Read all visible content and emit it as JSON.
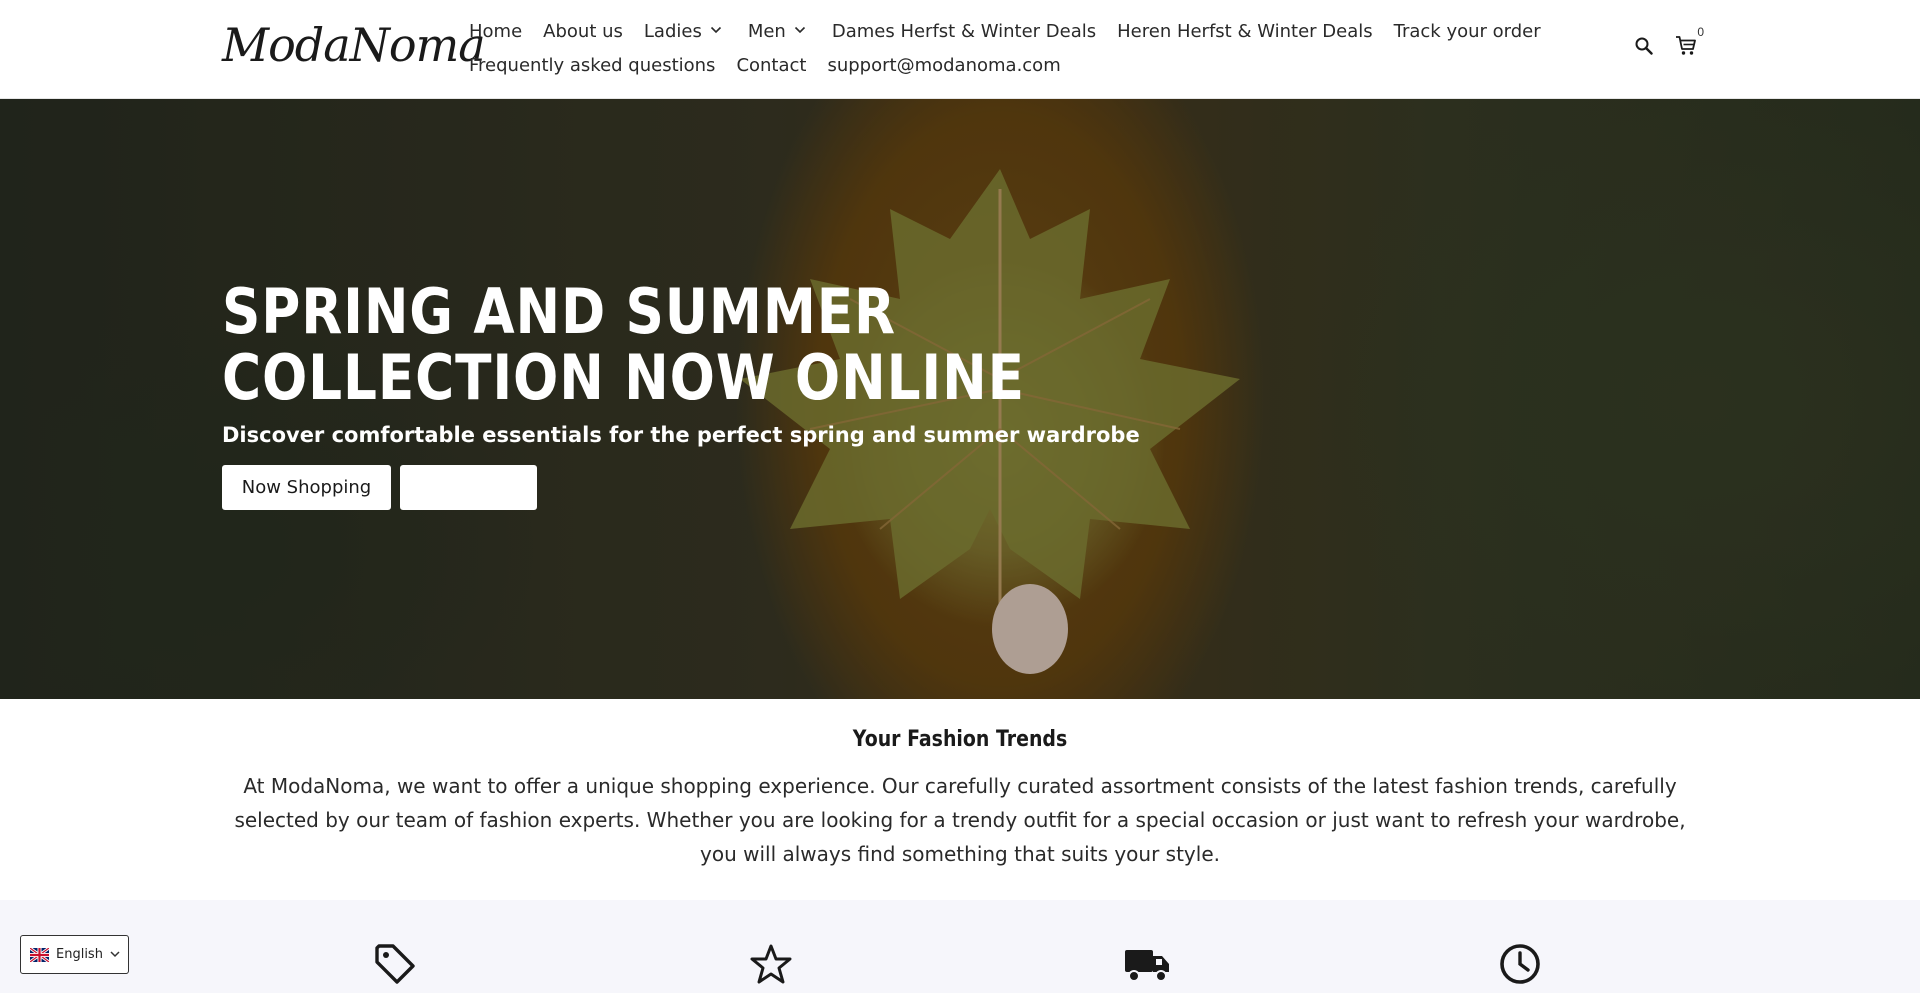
{
  "header": {
    "logo": "ModaNoma",
    "nav_row1": [
      {
        "label": "Home",
        "dropdown": false
      },
      {
        "label": "About us",
        "dropdown": false
      },
      {
        "label": "Ladies",
        "dropdown": true
      },
      {
        "label": "Men",
        "dropdown": true
      },
      {
        "label": "Dames Herfst & Winter Deals",
        "dropdown": false
      },
      {
        "label": "Heren Herfst & Winter Deals",
        "dropdown": false
      },
      {
        "label": "Track your order",
        "dropdown": false
      }
    ],
    "nav_row2": [
      {
        "label": "Frequently asked questions"
      },
      {
        "label": "Contact"
      },
      {
        "label": "support@modanoma.com"
      }
    ],
    "cart_count": "0",
    "icons": [
      "search-icon",
      "cart-icon"
    ]
  },
  "hero": {
    "title": "SPRING AND SUMMER COLLECTION NOW ONLINE",
    "subtitle": "Discover comfortable essentials for the perfect spring and summer wardrobe",
    "primary_button": "Now Shopping",
    "secondary_button": ""
  },
  "intro": {
    "title": "Your Fashion Trends",
    "text": "At ModaNoma, we want to offer a unique shopping experience. Our carefully curated assortment consists of the latest fashion trends, carefully selected by our team of fashion experts. Whether you are looking for a trendy outfit for a special occasion or just want to refresh your wardrobe, you will always find something that suits your style."
  },
  "features": {
    "icons": [
      "tag-icon",
      "star-icon",
      "truck-icon",
      "clock-icon"
    ]
  },
  "language": {
    "selected": "English",
    "flag": "uk-flag-icon"
  }
}
